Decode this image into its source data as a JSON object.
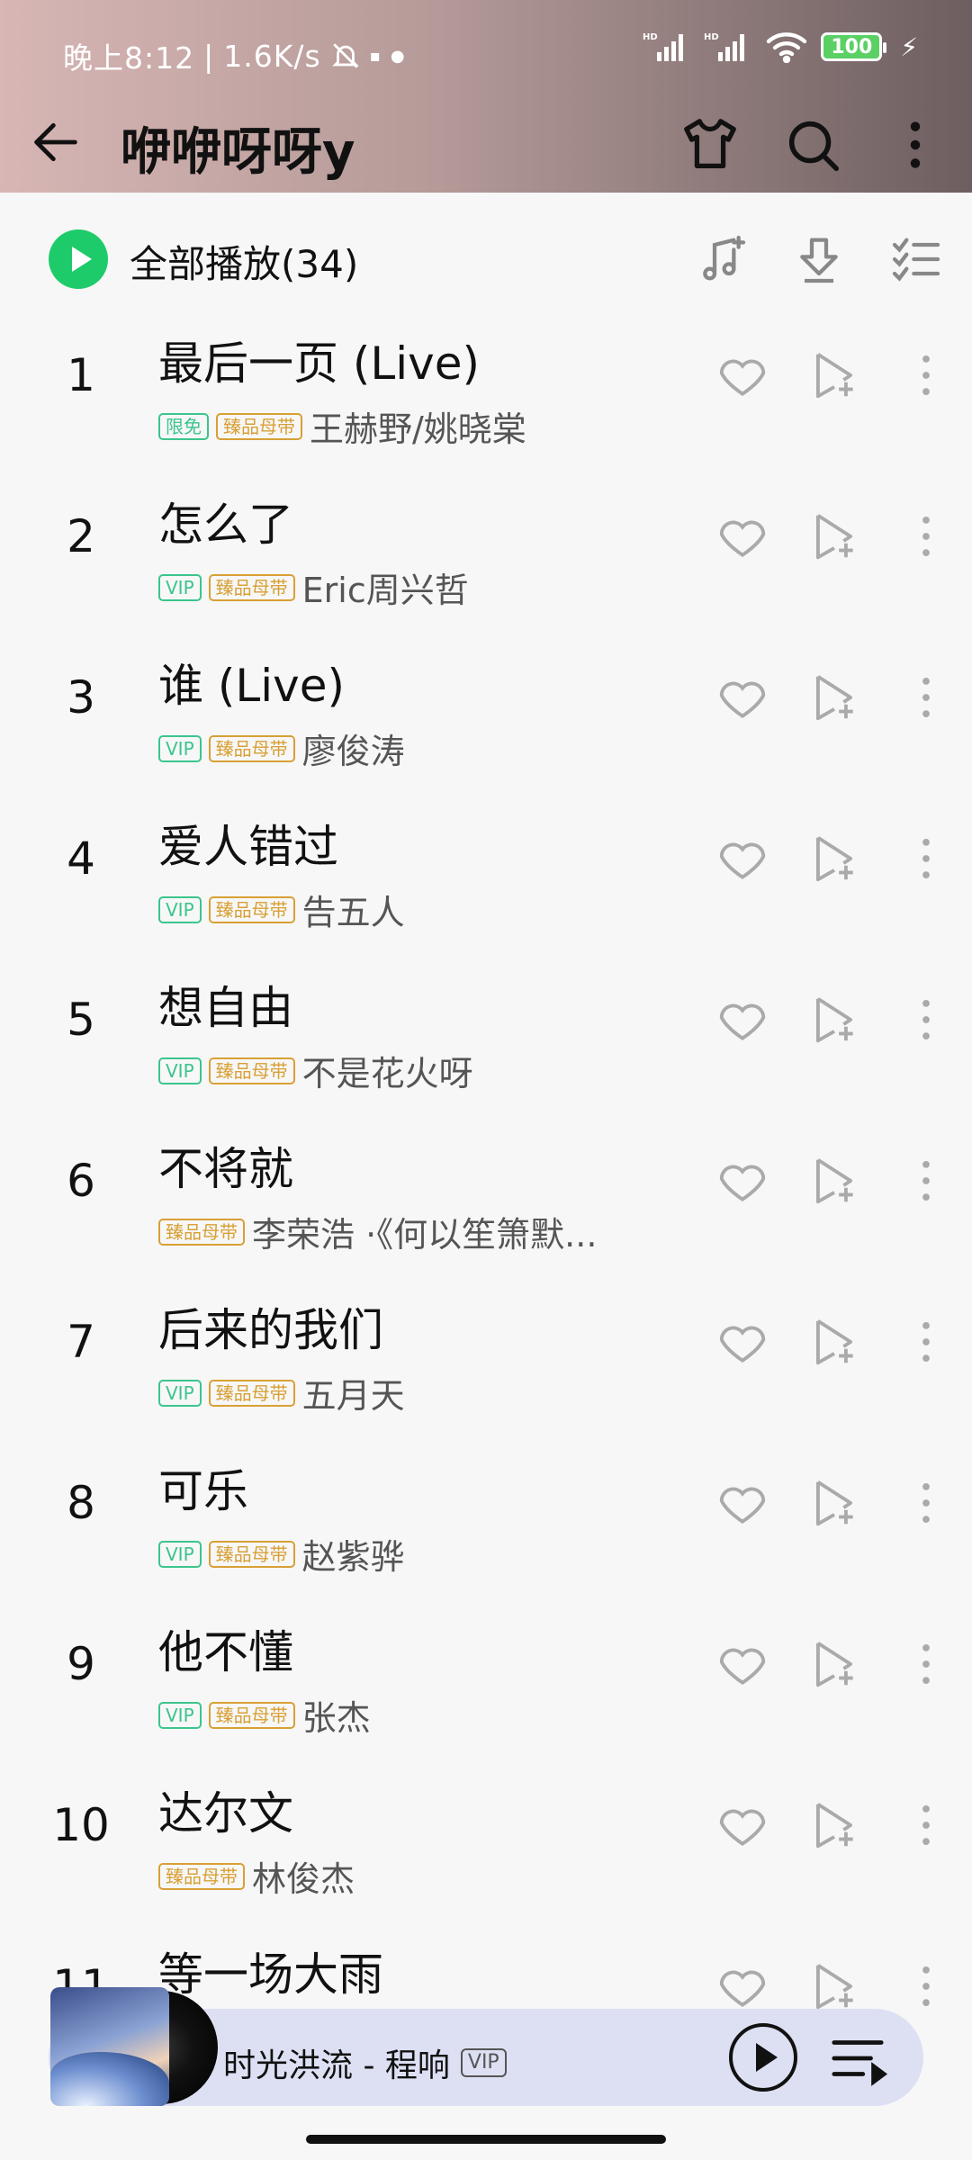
{
  "status_bar": {
    "time": "晚上8:12",
    "speed": "1.6K/s",
    "battery": "100"
  },
  "header": {
    "title": "咿咿呀呀y"
  },
  "play_all": {
    "label": "全部播放(34)"
  },
  "songs": [
    {
      "num": "1",
      "title": "最后一页 (Live)",
      "tags": [
        "限免",
        "臻品母带"
      ],
      "artist": "王赫野/姚晓棠"
    },
    {
      "num": "2",
      "title": "怎么了",
      "tags": [
        "VIP",
        "臻品母带"
      ],
      "artist": "Eric周兴哲"
    },
    {
      "num": "3",
      "title": "谁 (Live)",
      "tags": [
        "VIP",
        "臻品母带"
      ],
      "artist": "廖俊涛"
    },
    {
      "num": "4",
      "title": "爱人错过",
      "tags": [
        "VIP",
        "臻品母带"
      ],
      "artist": "告五人"
    },
    {
      "num": "5",
      "title": "想自由",
      "tags": [
        "VIP",
        "臻品母带"
      ],
      "artist": "不是花火呀"
    },
    {
      "num": "6",
      "title": "不将就",
      "tags": [
        "臻品母带"
      ],
      "artist": "李荣浩 ·《何以笙箫默..."
    },
    {
      "num": "7",
      "title": "后来的我们",
      "tags": [
        "VIP",
        "臻品母带"
      ],
      "artist": "五月天"
    },
    {
      "num": "8",
      "title": "可乐",
      "tags": [
        "VIP",
        "臻品母带"
      ],
      "artist": "赵紫骅"
    },
    {
      "num": "9",
      "title": "他不懂",
      "tags": [
        "VIP",
        "臻品母带"
      ],
      "artist": "张杰"
    },
    {
      "num": "10",
      "title": "达尔文",
      "tags": [
        "臻品母带"
      ],
      "artist": "林俊杰"
    },
    {
      "num": "11",
      "title": "等一场大雨",
      "tags": [],
      "artist": ""
    }
  ],
  "now_playing": {
    "text": "时光洪流 - 程响",
    "tag": "VIP"
  },
  "icons": {
    "back": "back-arrow-icon",
    "theme": "tshirt-icon",
    "search": "search-icon",
    "more": "more-vertical-icon",
    "add_music": "add-music-icon",
    "download": "download-icon",
    "multi_select": "multi-select-icon",
    "like": "heart-icon",
    "add_to_playlist": "add-to-playlist-icon",
    "song_more": "more-vertical-icon",
    "play": "play-icon",
    "playlist": "playlist-icon"
  }
}
